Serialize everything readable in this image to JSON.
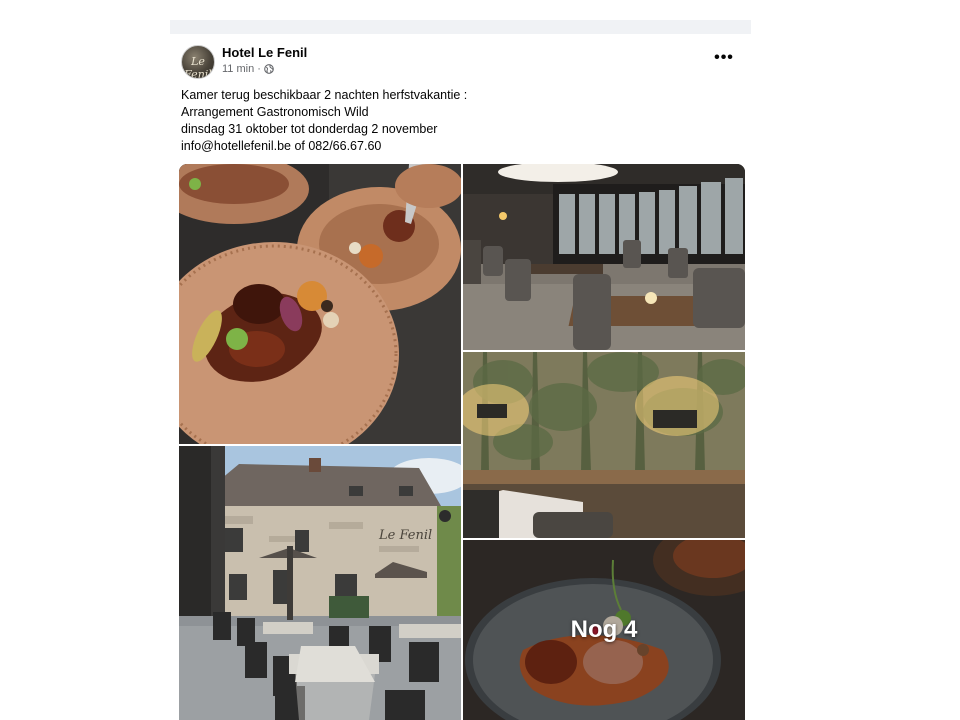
{
  "post": {
    "author": "Hotel Le Fenil",
    "avatar_text": "Le Fenil",
    "time": "11 min",
    "separator": "·",
    "privacy_icon": "globe-icon",
    "more_icon": "more-horizontal-icon",
    "more_label": "•••",
    "text_lines": [
      "Kamer terug beschikbaar 2 nachten herfstvakantie :",
      "Arrangement Gastronomisch Wild",
      "dinsdag 31 oktober tot donderdag 2 november",
      "info@hotellefenil.be of 082/66.67.60"
    ]
  },
  "photos": {
    "more_label": "Nog 4",
    "sign_text": "Le Fenil"
  }
}
